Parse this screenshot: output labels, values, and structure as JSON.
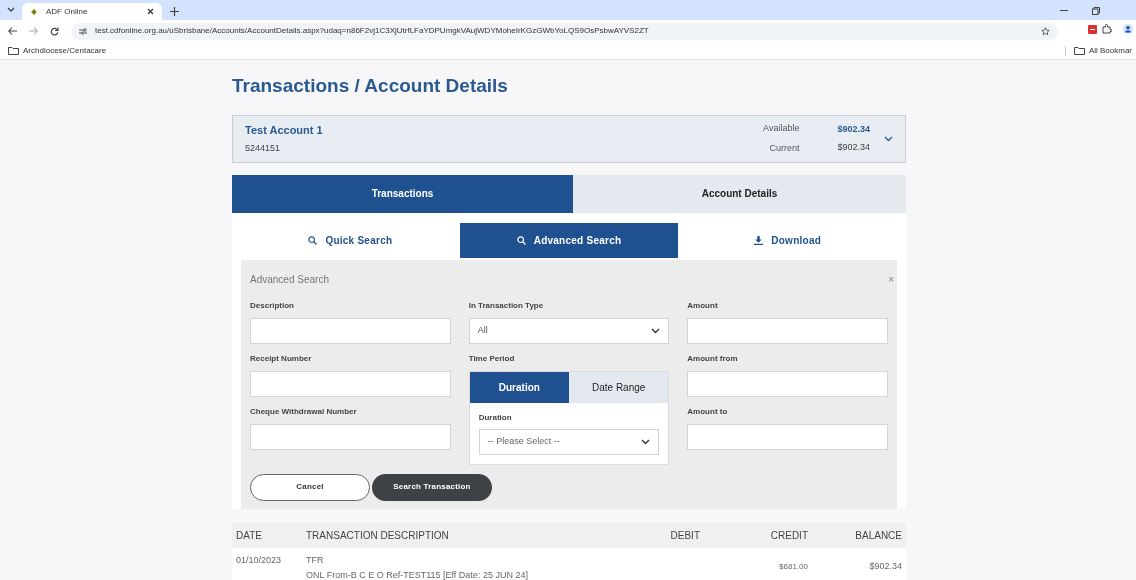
{
  "browser": {
    "tabs": [
      {
        "title": "ADF Online",
        "selected": true
      }
    ],
    "url": "test.cdfonline.org.au/uSbrisbane/Accounts/AccountDetails.aspx?udaq=n86F2vj1C3XjUtrfLFaYDPUmgkVAujWDYMoheIrKGzGWbYoLQS9OsPsbwAYVS2ZT",
    "bookmarks": [
      {
        "label": "Archdiocese/Centacare"
      }
    ],
    "all_bookmarks": "All Bookmar"
  },
  "page": {
    "title": "Transactions / Account Details",
    "account": {
      "name": "Test Account 1",
      "number": "5244151",
      "available_label": "Available",
      "available": "$902.34",
      "current_label": "Current",
      "current": "$902.34"
    },
    "main_tabs": [
      {
        "label": "Transactions",
        "selected": true
      },
      {
        "label": "Account Details",
        "selected": false
      }
    ],
    "search_tabs": [
      {
        "label": "Quick Search",
        "kind": "search",
        "selected": false
      },
      {
        "label": "Advanced Search",
        "kind": "search",
        "selected": true
      },
      {
        "label": "Download",
        "kind": "download",
        "selected": false
      }
    ],
    "advanced_search": {
      "title": "Advanced Search",
      "close": "×",
      "columns": [
        [
          {
            "kind": "text",
            "label": "Description"
          },
          {
            "kind": "text",
            "label": "Receipt Number"
          },
          {
            "kind": "text",
            "label": "Cheque Withdrawal Number"
          }
        ],
        [
          {
            "kind": "select",
            "label": "In Transaction Type",
            "value": "All"
          },
          {
            "kind": "period",
            "label": "Time Period",
            "tabs": [
              {
                "label": "Duration",
                "selected": true
              },
              {
                "label": "Date Range",
                "selected": false
              }
            ],
            "sub_label": "Duration",
            "placeholder": "-- Please Select --"
          }
        ],
        [
          {
            "kind": "text",
            "label": "Amount"
          },
          {
            "kind": "text",
            "label": "Amount from"
          },
          {
            "kind": "text",
            "label": "Amount to"
          }
        ]
      ],
      "buttons": [
        {
          "kind": "secondary",
          "label": "Cancel"
        },
        {
          "kind": "primary",
          "label": "Search Transaction"
        }
      ]
    },
    "table": {
      "columns": [
        "DATE",
        "TRANSACTION DESCRIPTION",
        "DEBIT",
        "CREDIT",
        "BALANCE"
      ],
      "rows": [
        {
          "date": "01/10/2023",
          "description": [
            "TFR",
            "ONL From-B C E O Ref-TEST115 [Eff Date: 25 JUN 24]"
          ],
          "credit": "$681.00",
          "balance": "$902.34"
        }
      ]
    }
  }
}
